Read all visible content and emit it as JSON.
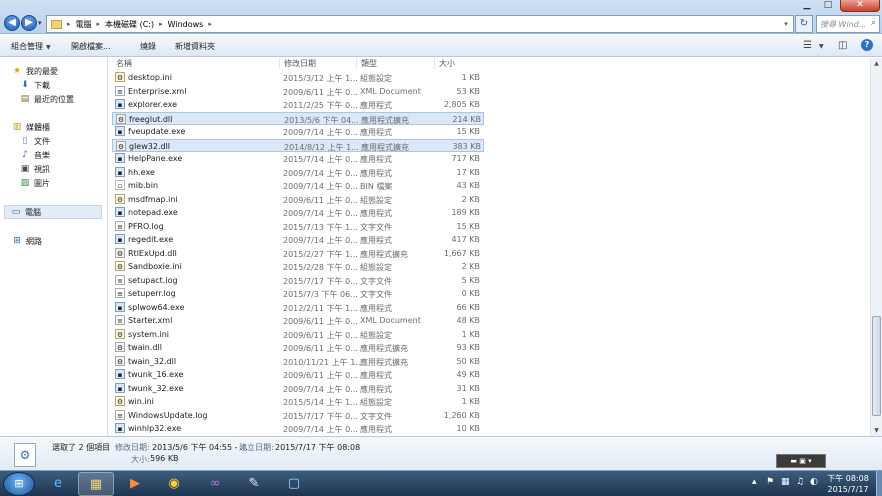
{
  "address": {
    "segments": [
      "電腦",
      "本機磁碟 (C:)",
      "Windows"
    ],
    "search_placeholder": "搜尋 Wind..."
  },
  "toolbar": {
    "organize": "組合管理",
    "open": "開啟檔案...",
    "burn": "燒錄",
    "new_folder": "新增資料夾"
  },
  "nav": {
    "favorites": "我的最愛",
    "downloads": "下載",
    "recent_places": "最近的位置",
    "libraries": "媒體櫃",
    "documents": "文件",
    "music": "音樂",
    "videos": "視訊",
    "pictures": "圖片",
    "computer": "電腦",
    "network": "網路"
  },
  "columns": {
    "name": "名稱",
    "date": "修改日期",
    "type": "類型",
    "size": "大小"
  },
  "files": [
    {
      "name": "desktop.ini",
      "date": "2015/3/12 上午 1...",
      "type": "組態設定",
      "size": "1 KB",
      "icon": "ini"
    },
    {
      "name": "Enterprise.xml",
      "date": "2009/6/11 上午 0...",
      "type": "XML Document",
      "size": "53 KB",
      "icon": "xml"
    },
    {
      "name": "explorer.exe",
      "date": "2011/2/25 下午 0...",
      "type": "應用程式",
      "size": "2,805 KB",
      "icon": "exe"
    },
    {
      "name": "freeglut.dll",
      "date": "2013/5/6 下午 04...",
      "type": "應用程式擴充",
      "size": "214 KB",
      "icon": "dll",
      "selected": true
    },
    {
      "name": "fveupdate.exe",
      "date": "2009/7/14 上午 0...",
      "type": "應用程式",
      "size": "15 KB",
      "icon": "exe"
    },
    {
      "name": "glew32.dll",
      "date": "2014/8/12 上午 1...",
      "type": "應用程式擴充",
      "size": "383 KB",
      "icon": "dll",
      "selected": true
    },
    {
      "name": "HelpPane.exe",
      "date": "2015/7/14 上午 0...",
      "type": "應用程式",
      "size": "717 KB",
      "icon": "exe"
    },
    {
      "name": "hh.exe",
      "date": "2009/7/14 上午 0...",
      "type": "應用程式",
      "size": "17 KB",
      "icon": "exe"
    },
    {
      "name": "mib.bin",
      "date": "2009/7/14 上午 0...",
      "type": "BIN 檔案",
      "size": "43 KB",
      "icon": "bin"
    },
    {
      "name": "msdfmap.ini",
      "date": "2009/6/11 上午 0...",
      "type": "組態設定",
      "size": "2 KB",
      "icon": "ini"
    },
    {
      "name": "notepad.exe",
      "date": "2009/7/14 上午 0...",
      "type": "應用程式",
      "size": "189 KB",
      "icon": "exe"
    },
    {
      "name": "PFRO.log",
      "date": "2015/7/13 下午 1...",
      "type": "文字文件",
      "size": "15 KB",
      "icon": "txt"
    },
    {
      "name": "regedit.exe",
      "date": "2009/7/14 上午 0...",
      "type": "應用程式",
      "size": "417 KB",
      "icon": "exe"
    },
    {
      "name": "RtlExUpd.dll",
      "date": "2015/2/27 下午 1...",
      "type": "應用程式擴充",
      "size": "1,667 KB",
      "icon": "dll"
    },
    {
      "name": "Sandboxie.ini",
      "date": "2015/2/28 下午 0...",
      "type": "組態設定",
      "size": "2 KB",
      "icon": "ini"
    },
    {
      "name": "setupact.log",
      "date": "2015/7/17 下午 0...",
      "type": "文字文件",
      "size": "5 KB",
      "icon": "txt"
    },
    {
      "name": "setuperr.log",
      "date": "2015/7/3 下午 06...",
      "type": "文字文件",
      "size": "0 KB",
      "icon": "txt"
    },
    {
      "name": "splwow64.exe",
      "date": "2012/2/11 下午 1...",
      "type": "應用程式",
      "size": "66 KB",
      "icon": "exe"
    },
    {
      "name": "Starter.xml",
      "date": "2009/6/11 上午 0...",
      "type": "XML Document",
      "size": "48 KB",
      "icon": "xml"
    },
    {
      "name": "system.ini",
      "date": "2009/6/11 上午 0...",
      "type": "組態設定",
      "size": "1 KB",
      "icon": "ini"
    },
    {
      "name": "twain.dll",
      "date": "2009/6/11 上午 0...",
      "type": "應用程式擴充",
      "size": "93 KB",
      "icon": "dll"
    },
    {
      "name": "twain_32.dll",
      "date": "2010/11/21 上午 1...",
      "type": "應用程式擴充",
      "size": "50 KB",
      "icon": "dll"
    },
    {
      "name": "twunk_16.exe",
      "date": "2009/6/11 上午 0...",
      "type": "應用程式",
      "size": "49 KB",
      "icon": "exe"
    },
    {
      "name": "twunk_32.exe",
      "date": "2009/7/14 上午 0...",
      "type": "應用程式",
      "size": "31 KB",
      "icon": "exe"
    },
    {
      "name": "win.ini",
      "date": "2015/5/14 上午 1...",
      "type": "組態設定",
      "size": "1 KB",
      "icon": "ini"
    },
    {
      "name": "WindowsUpdate.log",
      "date": "2015/7/17 下午 0...",
      "type": "文字文件",
      "size": "1,260 KB",
      "icon": "txt"
    },
    {
      "name": "winhlp32.exe",
      "date": "2009/7/14 上午 0...",
      "type": "應用程式",
      "size": "10 KB",
      "icon": "exe"
    }
  ],
  "details": {
    "selected_count": "選取了 2 個項目",
    "modified_label": "修改日期:",
    "modified_value": "2013/5/6 下午 04:55 - ...",
    "created_label": "建立日期:",
    "created_value": "2015/7/17 下午 08:08",
    "size_label": "大小:",
    "size_value": "596 KB"
  },
  "taskbar": {
    "time": "下午 08:08",
    "date": "2015/7/17"
  }
}
